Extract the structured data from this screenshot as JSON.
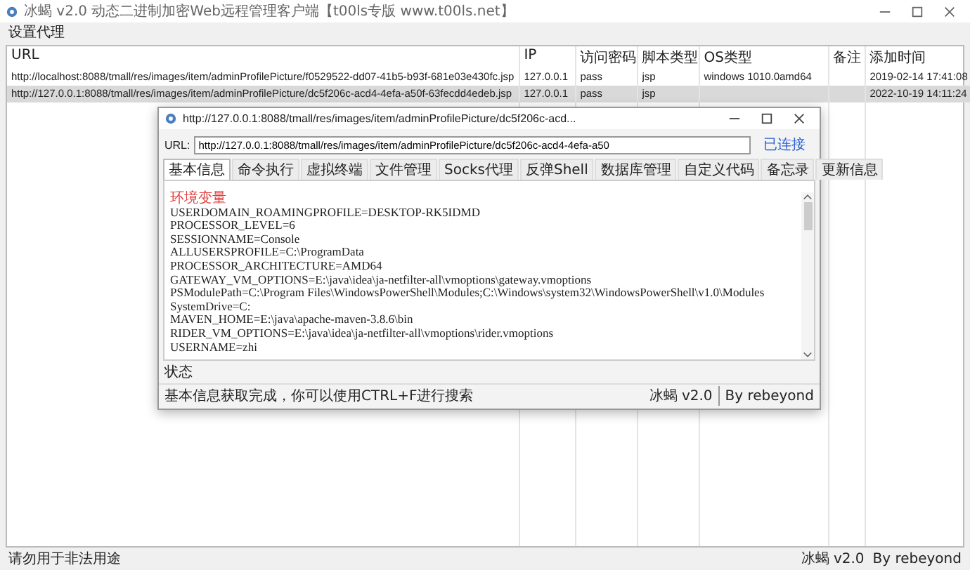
{
  "window": {
    "title": "冰蝎 v2.0 动态二进制加密Web远程管理客户端【t00ls专版 www.t00ls.net】"
  },
  "menu": [
    {
      "label": "设置代理"
    }
  ],
  "table": {
    "columns": [
      "URL",
      "IP",
      "访问密码",
      "脚本类型",
      "OS类型",
      "备注",
      "添加时间"
    ],
    "rows": [
      {
        "cells": [
          "http://localhost:8088/tmall/res/images/item/adminProfilePicture/f0529522-dd07-41b5-b93f-681e03e430fc.jsp",
          "127.0.0.1",
          "pass",
          "jsp",
          "windows 1010.0amd64",
          "",
          "2019-02-14 17:41:08"
        ],
        "selected": false
      },
      {
        "cells": [
          "http://127.0.0.1:8088/tmall/res/images/item/adminProfilePicture/dc5f206c-acd4-4efa-a50f-63fecdd4edeb.jsp",
          "127.0.0.1",
          "pass",
          "jsp",
          "",
          "",
          "2022-10-19 14:11:24"
        ],
        "selected": true
      }
    ]
  },
  "dialog": {
    "title": "http://127.0.0.1:8088/tmall/res/images/item/adminProfilePicture/dc5f206c-acd...",
    "url_label": "URL:",
    "url": "http://127.0.0.1:8088/tmall/res/images/item/adminProfilePicture/dc5f206c-acd4-4efa-a50",
    "connection_status": "已连接",
    "tabs": [
      {
        "label": "基本信息",
        "selected": true
      },
      {
        "label": "命令执行",
        "selected": false
      },
      {
        "label": "虚拟终端",
        "selected": false
      },
      {
        "label": "文件管理",
        "selected": false
      },
      {
        "label": "Socks代理",
        "selected": false
      },
      {
        "label": "反弹Shell",
        "selected": false
      },
      {
        "label": "数据库管理",
        "selected": false
      },
      {
        "label": "自定义代码",
        "selected": false
      },
      {
        "label": "备忘录",
        "selected": false
      },
      {
        "label": "更新信息",
        "selected": false
      }
    ],
    "content": {
      "heading": "环境变量",
      "lines": [
        "USERDOMAIN_ROAMINGPROFILE=DESKTOP-RK5IDMD",
        "PROCESSOR_LEVEL=6",
        "SESSIONNAME=Console",
        "ALLUSERSPROFILE=C:\\ProgramData",
        "PROCESSOR_ARCHITECTURE=AMD64",
        "GATEWAY_VM_OPTIONS=E:\\java\\idea\\ja-netfilter-all\\vmoptions\\gateway.vmoptions",
        "PSModulePath=C:\\Program Files\\WindowsPowerShell\\Modules;C:\\Windows\\system32\\WindowsPowerShell\\v1.0\\Modules",
        "SystemDrive=C:",
        "MAVEN_HOME=E:\\java\\apache-maven-3.8.6\\bin",
        "RIDER_VM_OPTIONS=E:\\java\\idea\\ja-netfilter-all\\vmoptions\\rider.vmoptions",
        "USERNAME=zhi"
      ]
    },
    "status_label": "状态",
    "status_message": "基本信息获取完成，你可以使用CTRL+F进行搜索",
    "version": "冰蝎 v2.0",
    "author": "By rebeyond"
  },
  "status_bar": {
    "message": "请勿用于非法用途",
    "version": "冰蝎 v2.0",
    "author": "By rebeyond"
  }
}
